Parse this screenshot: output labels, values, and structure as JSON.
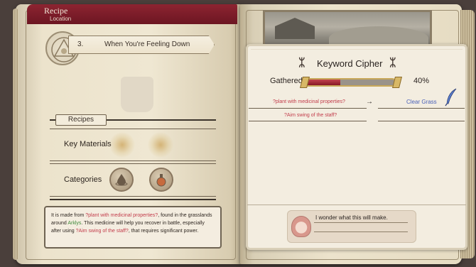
{
  "header": {
    "tab_title": "Recipe",
    "tab_subtitle": "Location"
  },
  "recipe": {
    "number": "3.",
    "title": "When You're Feeling Down",
    "recipes_label": "Recipes",
    "key_materials_label": "Key Materials",
    "categories_label": "Categories",
    "category_icons": [
      "water-drop-icon",
      "potion-flask-icon"
    ],
    "description": {
      "part1": "It is made from ",
      "kw1": "?plant with medicinal properties?",
      "part2": ", found in the grasslands around ",
      "place": "Arklys",
      "part3": ". This medicine will help you recover in battle, especially after using ",
      "kw2": "?Aim swing of the staff?",
      "part4": ", that requires significant power."
    }
  },
  "cipher": {
    "title": "Keyword Cipher",
    "gathered_label": "Gathered",
    "gathered_percent": "40%",
    "gathered_value": 40,
    "hint1": "?plant with medicinal properties?",
    "hint2": "?Aim swing of the staff?",
    "arrow": "→",
    "solution1": "Clear Grass",
    "accent_colors": {
      "keyword": "#c23b4a",
      "solution": "#4a61b8",
      "gauge_fill": "#a82a38",
      "tab": "#7f1d2a"
    }
  },
  "dialog": {
    "text": "I wonder what this will make."
  }
}
